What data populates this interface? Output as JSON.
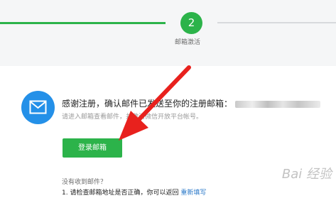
{
  "steps": {
    "current_number": "2",
    "current_label": "邮箱激活"
  },
  "message": {
    "main": "感谢注册，确认邮件已发送至你的注册邮箱：",
    "sub": "请进入邮箱查看邮件，并激活微信开放平台帐号。"
  },
  "buttons": {
    "login": "登录邮箱"
  },
  "help": {
    "no_receive": "没有收到邮件？",
    "tip1_text": "1. 请检查邮箱地址是否正确，你可以返回",
    "tip1_link": "重新填写"
  },
  "watermark": "Bai 经验",
  "colors": {
    "green": "#2cb34a",
    "blue": "#2490e8",
    "arrow": "#e8211d",
    "link": "#2a78c8"
  },
  "icons": {
    "mail": "mail-icon"
  }
}
